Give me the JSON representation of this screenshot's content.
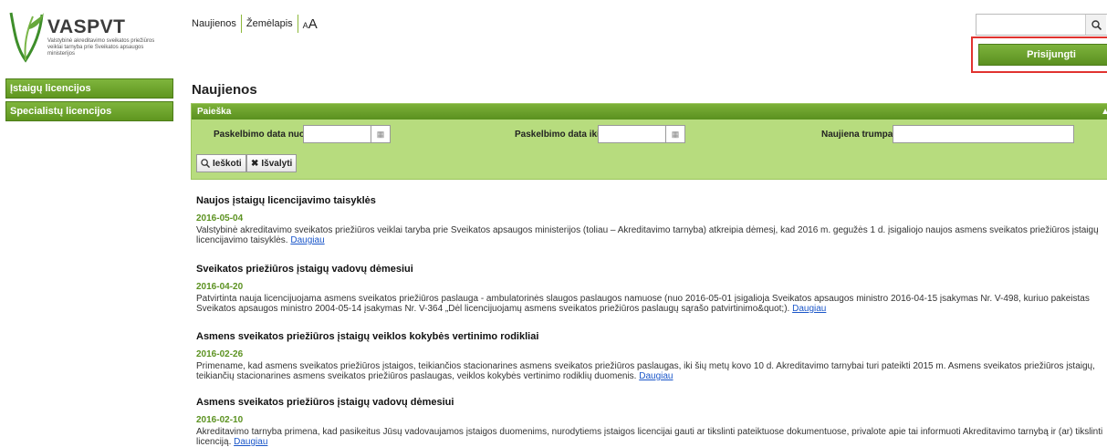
{
  "header": {
    "logo_title": "VASPVT",
    "logo_subtitle": "Valstybinė akreditavimo sveikatos priežiūros veiklai tarnyba prie Sveikatos apsaugos ministerijos",
    "nav": {
      "news": "Naujienos",
      "sitemap": "Žemėlapis",
      "font_small": "A",
      "font_big": "A"
    },
    "search": {
      "placeholder": "",
      "icon": "search-icon"
    },
    "login_label": "Prisijungti"
  },
  "sidebar": {
    "items": [
      {
        "label": "Įstaigų licencijos"
      },
      {
        "label": "Specialistų licencijos"
      }
    ]
  },
  "main": {
    "title": "Naujienos",
    "search_panel": {
      "header": "Paieška",
      "date_from_label": "Paskelbimo data nuo",
      "date_to_label": "Paskelbimo data iki",
      "short_label": "Naujiena trumpai",
      "date_from_value": "",
      "date_to_value": "",
      "short_value": "",
      "search_button": "Ieškoti",
      "clear_button": "Išvalyti"
    },
    "more_link": "Daugiau",
    "news": [
      {
        "title": "Naujos įstaigų licencijavimo taisyklės",
        "date": "2016-05-04",
        "text": "Valstybinė akreditavimo sveikatos priežiūros veiklai taryba prie Sveikatos apsaugos ministerijos (toliau – Akreditavimo tarnyba) atkreipia dėmesį, kad 2016 m. gegužės 1 d. įsigaliojo naujos asmens sveikatos priežiūros įstaigų licencijavimo taisyklės."
      },
      {
        "title": "Sveikatos priežiūros įstaigų vadovų dėmesiui",
        "date": "2016-04-20",
        "text": "Patvirtinta nauja licencijuojama asmens sveikatos priežiūros paslauga - ambulatorinės slaugos paslaugos namuose (nuo 2016-05-01 įsigalioja Sveikatos apsaugos ministro 2016-04-15 įsakymas Nr. V-498, kuriuo pakeistas Sveikatos apsaugos ministro 2004-05-14 įsakymas Nr. V-364 „Dėl licencijuojamų asmens sveikatos priežiūros paslaugų sąrašo patvirtinimo&quot;)."
      },
      {
        "title": "Asmens sveikatos priežiūros įstaigų veiklos kokybės vertinimo rodikliai",
        "date": "2016-02-26",
        "text": "Primename, kad asmens sveikatos priežiūros įstaigos, teikiančios stacionarines asmens sveikatos priežiūros paslaugas, iki šių metų kovo 10 d. Akreditavimo tarnybai turi pateikti 2015 m. Asmens sveikatos priežiūros įstaigų, teikiančių stacionarines asmens sveikatos priežiūros paslaugas, veiklos kokybės vertinimo rodiklių duomenis."
      },
      {
        "title": "Asmens sveikatos priežiūros įstaigų vadovų dėmesiui",
        "date": "2016-02-10",
        "text": "Akreditavimo tarnyba primena, kad pasikeitus Jūsų vadovaujamos įstaigos duomenims, nurodytiems įstaigos licencijai gauti ar tikslinti pateiktuose dokumentuose, privalote apie tai informuoti Akreditavimo tarnybą ir (ar) tikslinti licenciją."
      }
    ]
  }
}
